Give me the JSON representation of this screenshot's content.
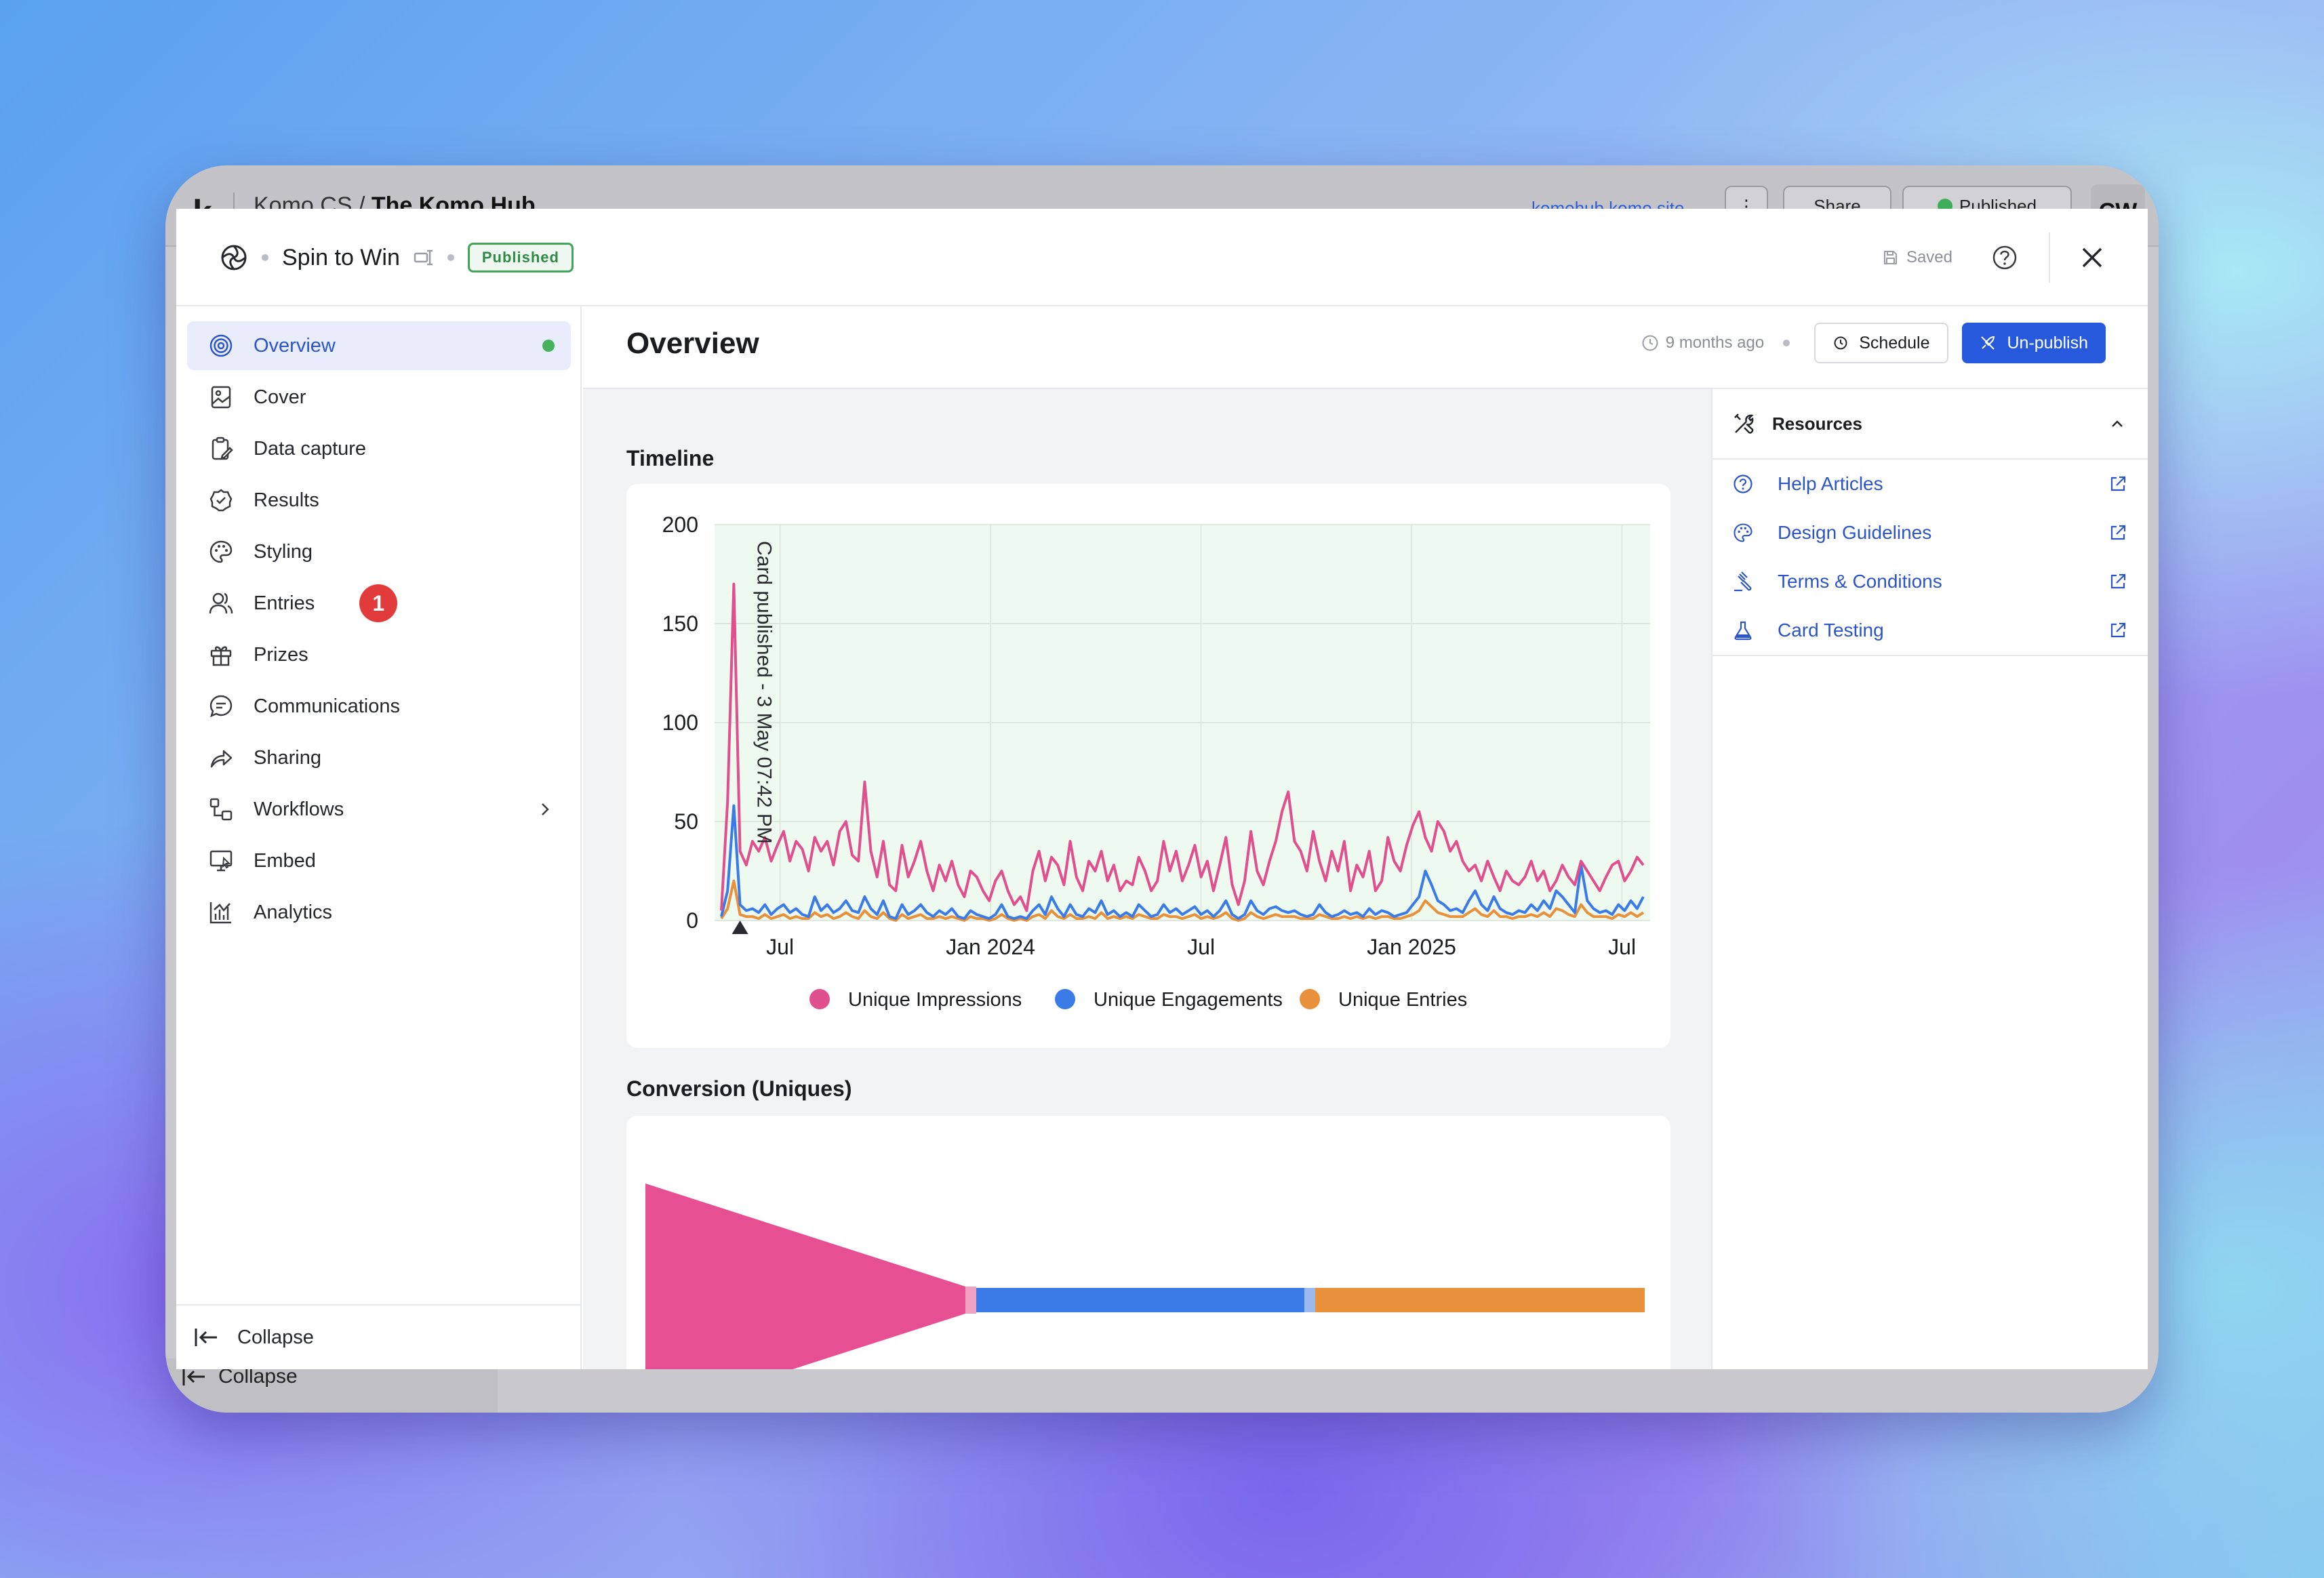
{
  "background_app": {
    "logo": "k",
    "breadcrumb_org": "Komo CS",
    "breadcrumb_sep": "/",
    "breadcrumb_hub": "The Komo Hub",
    "site_link": "komohub.komo.site",
    "more_label": "⋮",
    "share_label": "Share",
    "status_label": "Published",
    "avatar": "CW",
    "collapse_label": "Collapse"
  },
  "modal": {
    "card_title": "Spin to Win",
    "status_badge": "Published",
    "saved_label": "Saved"
  },
  "sidebar": {
    "items": [
      {
        "label": "Overview",
        "icon": "target-icon",
        "active": true
      },
      {
        "label": "Cover",
        "icon": "cover-image-icon"
      },
      {
        "label": "Data capture",
        "icon": "clipboard-icon"
      },
      {
        "label": "Results",
        "icon": "check-circle-icon"
      },
      {
        "label": "Styling",
        "icon": "palette-icon"
      },
      {
        "label": "Entries",
        "icon": "users-icon",
        "badge": "1"
      },
      {
        "label": "Prizes",
        "icon": "gift-icon"
      },
      {
        "label": "Communications",
        "icon": "chat-icon"
      },
      {
        "label": "Sharing",
        "icon": "share-icon"
      },
      {
        "label": "Workflows",
        "icon": "workflow-icon"
      },
      {
        "label": "Embed",
        "icon": "monitor-icon"
      },
      {
        "label": "Analytics",
        "icon": "analytics-icon"
      }
    ],
    "collapse_label": "Collapse"
  },
  "main": {
    "title": "Overview",
    "time_ago": "9 months ago",
    "schedule_label": "Schedule",
    "unpublish_label": "Un-publish",
    "timeline_title": "Timeline",
    "conversion_title": "Conversion (Uniques)"
  },
  "resources": {
    "title": "Resources",
    "items": [
      {
        "label": "Help Articles",
        "icon": "help-circle-icon"
      },
      {
        "label": "Design Guidelines",
        "icon": "palette-icon"
      },
      {
        "label": "Terms & Conditions",
        "icon": "gavel-icon"
      },
      {
        "label": "Card Testing",
        "icon": "flask-icon"
      }
    ]
  },
  "colors": {
    "impressions": "#e04f8e",
    "engagements": "#3b7be8",
    "entries": "#e8913a",
    "accent": "#2659db",
    "plot_bg": "#eefaef"
  },
  "chart_data": {
    "type": "line",
    "title": "Timeline",
    "x_ticks": [
      "Jul",
      "Jan 2024",
      "Jul",
      "Jan 2025",
      "Jul"
    ],
    "y_ticks": [
      "0",
      "50",
      "100",
      "150",
      "200"
    ],
    "ylim": [
      0,
      200
    ],
    "annotation": "Card published - 3 May 07:42 PM",
    "legend": [
      "Unique Impressions",
      "Unique Engagements",
      "Unique Entries"
    ],
    "legend_position": "bottom",
    "grid": true,
    "series": [
      {
        "name": "Unique Impressions",
        "values": [
          5,
          60,
          170,
          35,
          28,
          40,
          35,
          42,
          30,
          38,
          45,
          30,
          40,
          36,
          25,
          42,
          35,
          40,
          28,
          45,
          50,
          33,
          30,
          70,
          35,
          22,
          40,
          18,
          15,
          38,
          22,
          30,
          40,
          25,
          15,
          28,
          20,
          30,
          18,
          12,
          25,
          22,
          15,
          10,
          20,
          25,
          15,
          8,
          12,
          5,
          25,
          35,
          20,
          32,
          28,
          18,
          40,
          22,
          15,
          30,
          25,
          35,
          20,
          28,
          15,
          20,
          18,
          32,
          25,
          15,
          20,
          40,
          25,
          35,
          20,
          28,
          38,
          22,
          30,
          15,
          28,
          42,
          18,
          8,
          20,
          45,
          25,
          18,
          30,
          40,
          55,
          65,
          40,
          35,
          25,
          45,
          30,
          20,
          35,
          25,
          40,
          15,
          28,
          22,
          35,
          15,
          20,
          42,
          30,
          25,
          38,
          48,
          55,
          42,
          35,
          50,
          45,
          35,
          40,
          30,
          25,
          28,
          20,
          30,
          22,
          15,
          25,
          20,
          18,
          22,
          30,
          20,
          25,
          15,
          20,
          28,
          22,
          18,
          30,
          25,
          20,
          15,
          22,
          28,
          30,
          20,
          25,
          32,
          28
        ]
      },
      {
        "name": "Unique Engagements",
        "values": [
          2,
          15,
          58,
          8,
          5,
          6,
          4,
          8,
          3,
          6,
          8,
          4,
          6,
          3,
          2,
          12,
          5,
          8,
          4,
          6,
          10,
          5,
          4,
          12,
          6,
          3,
          10,
          2,
          1,
          8,
          3,
          5,
          8,
          4,
          2,
          5,
          3,
          6,
          2,
          1,
          5,
          3,
          2,
          1,
          3,
          8,
          2,
          1,
          2,
          1,
          5,
          8,
          3,
          12,
          6,
          2,
          8,
          3,
          2,
          6,
          4,
          10,
          3,
          5,
          2,
          4,
          2,
          8,
          5,
          2,
          3,
          8,
          4,
          6,
          3,
          5,
          7,
          3,
          5,
          2,
          5,
          10,
          3,
          1,
          3,
          10,
          5,
          3,
          6,
          7,
          5,
          4,
          5,
          3,
          2,
          3,
          8,
          4,
          2,
          3,
          5,
          3,
          4,
          2,
          6,
          3,
          5,
          4,
          2,
          3,
          4,
          8,
          12,
          25,
          18,
          10,
          8,
          5,
          6,
          4,
          10,
          15,
          8,
          5,
          12,
          6,
          4,
          3,
          5,
          4,
          8,
          5,
          10,
          6,
          15,
          12,
          8,
          4,
          28,
          10,
          6,
          4,
          5,
          3,
          8,
          5,
          10,
          6,
          12
        ]
      },
      {
        "name": "Unique Entries",
        "values": [
          1,
          6,
          20,
          3,
          2,
          2,
          1,
          3,
          1,
          2,
          3,
          1,
          2,
          1,
          1,
          4,
          2,
          3,
          1,
          2,
          4,
          2,
          1,
          5,
          2,
          1,
          4,
          1,
          0,
          3,
          1,
          2,
          3,
          1,
          1,
          2,
          1,
          2,
          1,
          0,
          2,
          1,
          1,
          0,
          1,
          3,
          1,
          0,
          1,
          0,
          2,
          3,
          1,
          5,
          2,
          1,
          3,
          1,
          1,
          2,
          1,
          4,
          1,
          2,
          1,
          2,
          1,
          3,
          2,
          1,
          1,
          3,
          2,
          2,
          1,
          2,
          3,
          1,
          2,
          1,
          2,
          4,
          1,
          0,
          1,
          4,
          2,
          1,
          2,
          3,
          2,
          2,
          2,
          1,
          1,
          1,
          3,
          2,
          1,
          1,
          2,
          1,
          2,
          1,
          2,
          1,
          2,
          2,
          1,
          1,
          2,
          3,
          5,
          10,
          7,
          4,
          3,
          2,
          2,
          2,
          4,
          6,
          3,
          2,
          5,
          2,
          2,
          1,
          2,
          2,
          3,
          2,
          4,
          2,
          6,
          5,
          3,
          2,
          8,
          4,
          2,
          2,
          2,
          1,
          3,
          2,
          4,
          2,
          4
        ]
      }
    ]
  },
  "conversion_chart": {
    "type": "funnel",
    "stages": [
      "Unique Impressions",
      "Unique Engagements",
      "Unique Entries"
    ]
  }
}
